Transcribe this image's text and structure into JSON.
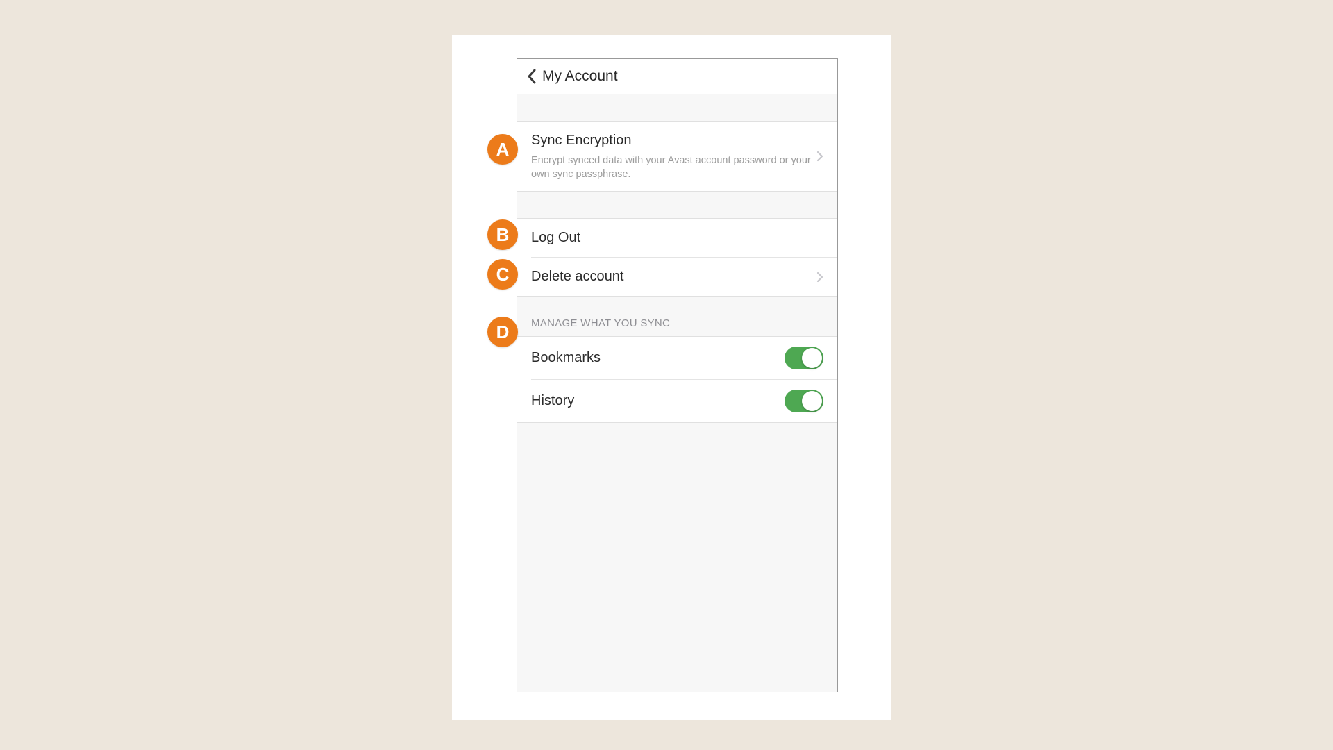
{
  "header": {
    "title": "My Account"
  },
  "sync_encryption": {
    "title": "Sync Encryption",
    "subtitle": "Encrypt synced data with your Avast account password or your own sync passphrase."
  },
  "account_actions": {
    "log_out": "Log Out",
    "delete_account": "Delete account"
  },
  "sync_section": {
    "header": "MANAGE WHAT YOU SYNC",
    "bookmarks": {
      "label": "Bookmarks",
      "enabled": true
    },
    "history": {
      "label": "History",
      "enabled": true
    }
  },
  "badges": {
    "a": "A",
    "b": "B",
    "c": "C",
    "d": "D"
  },
  "colors": {
    "badge_bg": "#ec7b1a",
    "toggle_on": "#4ea852",
    "page_bg": "#ede6dc"
  }
}
